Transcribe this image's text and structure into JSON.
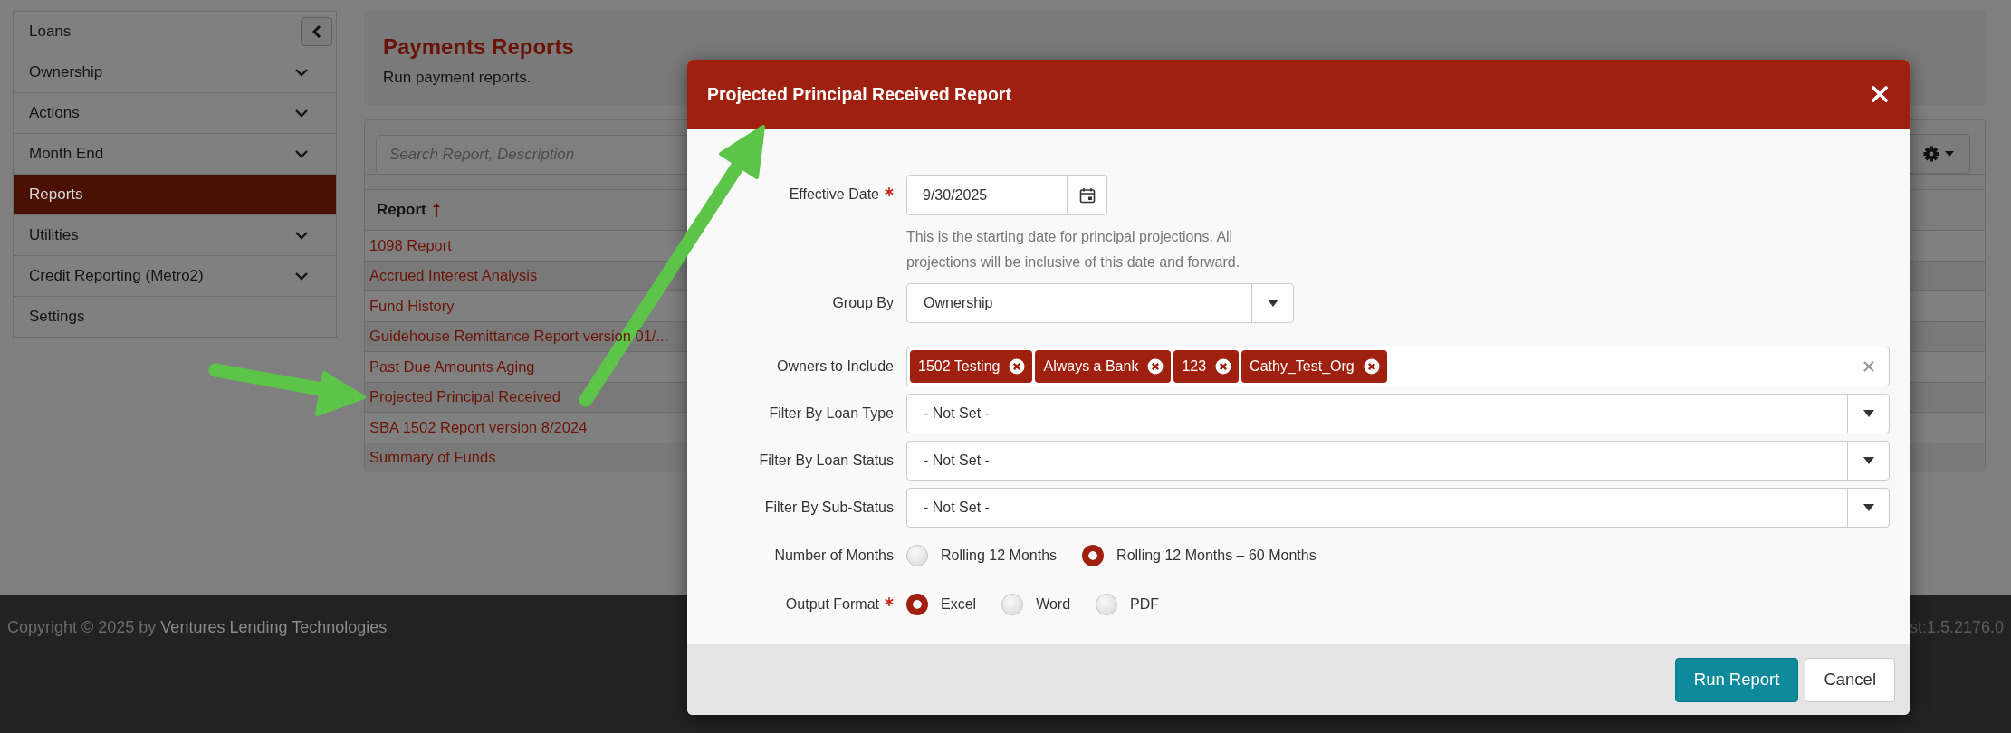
{
  "sidebar": {
    "items": [
      {
        "label": "Loans",
        "kind": "collapse",
        "selected": false
      },
      {
        "label": "Ownership",
        "kind": "expandable",
        "selected": false
      },
      {
        "label": "Actions",
        "kind": "expandable",
        "selected": false
      },
      {
        "label": "Month End",
        "kind": "expandable",
        "selected": false
      },
      {
        "label": "Reports",
        "kind": "link",
        "selected": true
      },
      {
        "label": "Utilities",
        "kind": "expandable",
        "selected": false
      },
      {
        "label": "Credit Reporting (Metro2)",
        "kind": "expandable",
        "selected": false
      },
      {
        "label": "Settings",
        "kind": "link",
        "selected": false
      }
    ]
  },
  "page": {
    "title": "Payments Reports",
    "subtitle": "Run payment reports."
  },
  "reports_table": {
    "search": {
      "placeholder": "Search Report, Description"
    },
    "columns": [
      {
        "label": "Report",
        "sorted": true
      }
    ],
    "rows": [
      "1098 Report",
      "Accrued Interest Analysis",
      "Fund History",
      "Guidehouse Remittance Report version 01/...",
      "Past Due Amounts Aging",
      "Projected Principal Received",
      "SBA 1502 Report version 8/2024",
      "Summary of Funds"
    ]
  },
  "modal": {
    "title": "Projected Principal Received Report",
    "fields": [
      {
        "kind": "date",
        "label": "Effective Date",
        "required": true,
        "value": "9/30/2025",
        "hint": "This is the starting date for principal projections. All projections will be inclusive of this date and forward."
      },
      {
        "kind": "dropdown",
        "label": "Group By",
        "required": false,
        "value": "Ownership"
      },
      {
        "kind": "tags",
        "label": "Owners to Include",
        "required": false,
        "tags": [
          "1502 Testing",
          "Always a Bank",
          "123",
          "Cathy_Test_Org"
        ]
      },
      {
        "kind": "select",
        "label": "Filter By Loan Type",
        "required": false,
        "value": "- Not Set -"
      },
      {
        "kind": "select",
        "label": "Filter By Loan Status",
        "required": false,
        "value": "- Not Set -"
      },
      {
        "kind": "select",
        "label": "Filter By Sub-Status",
        "required": false,
        "value": "- Not Set -"
      },
      {
        "kind": "radio",
        "label": "Number of Months",
        "required": false,
        "options": [
          {
            "label": "Rolling 12 Months",
            "selected": false
          },
          {
            "label": "Rolling 12 Months – 60 Months",
            "selected": true
          }
        ]
      },
      {
        "kind": "radio",
        "label": "Output Format",
        "required": true,
        "options": [
          {
            "label": "Excel",
            "selected": true
          },
          {
            "label": "Word",
            "selected": false
          },
          {
            "label": "PDF",
            "selected": false
          }
        ]
      }
    ],
    "buttons": [
      {
        "label": "Run Report",
        "kind": "primary"
      },
      {
        "label": "Cancel",
        "kind": "default"
      }
    ]
  },
  "footer": {
    "copyright": "Copyright © 2025 by",
    "company": "Ventures Lending Technologies",
    "version": "st:1.5.2176.0"
  }
}
